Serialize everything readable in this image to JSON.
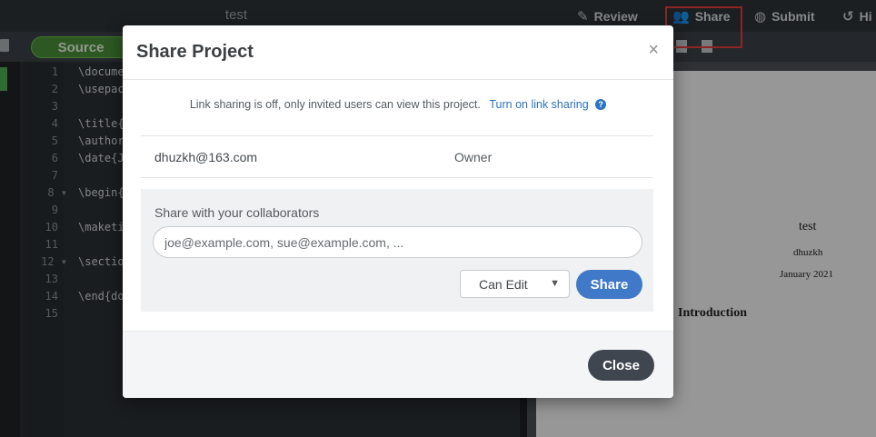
{
  "topbar": {
    "title": "test",
    "review_label": "Review",
    "share_label": "Share",
    "submit_label": "Submit",
    "history_label": "Hi"
  },
  "toolbar": {
    "source_label": "Source"
  },
  "editor": {
    "line_numbers": [
      "1",
      "2",
      "3",
      "4",
      "5",
      "6",
      "7",
      "8 ▾",
      "9",
      "10",
      "11",
      "12 ▾",
      "13",
      "14",
      "15"
    ],
    "lines": [
      "\\documen",
      "\\usepack",
      "",
      "\\title{t",
      "\\author-",
      "\\date{Ja",
      "",
      "\\begin{d",
      "",
      "\\maketit",
      "",
      "\\section",
      "",
      "\\end{doc",
      ""
    ]
  },
  "pdf": {
    "title": "test",
    "author": "dhuzkh",
    "date": "January 2021",
    "section": "Introduction"
  },
  "modal": {
    "title": "Share Project",
    "close_x": "×",
    "link_sharing_text": "Link sharing is off, only invited users can view this project.",
    "link_sharing_action": "Turn on link sharing",
    "help_icon": "?",
    "member": {
      "email": "dhuzkh@163.com",
      "role": "Owner"
    },
    "invite_label": "Share with your collaborators",
    "invite_placeholder": "joe@example.com, sue@example.com, ...",
    "permission_selected": "Can Edit",
    "share_button": "Share",
    "close_button": "Close"
  },
  "colors": {
    "accent_blue": "#3f79c8",
    "source_green": "#4a8f3a",
    "highlight_red": "#e53b3b"
  }
}
